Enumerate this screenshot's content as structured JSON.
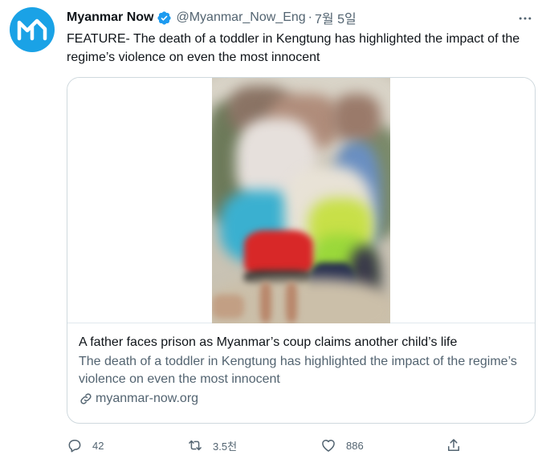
{
  "tweet": {
    "author_name": "Myanmar Now",
    "handle": "@Myanmar_Now_Eng",
    "separator": "·",
    "date": "7월 5일",
    "text": "FEATURE- The death of a toddler in Kengtung has highlighted the impact of the regime’s violence on even the most innocent"
  },
  "card": {
    "title": "A father faces prison as Myanmar’s coup claims another child’s life",
    "description": "The death of a toddler in Kengtung has highlighted the impact of the regime’s violence on even the most innocent",
    "domain": "myanmar-now.org"
  },
  "actions": {
    "reply_count": "42",
    "retweet_count": "3.5천",
    "like_count": "886"
  },
  "icons": [
    "avatar-logo",
    "verified-badge-icon",
    "more-icon",
    "link-icon",
    "reply-icon",
    "retweet-icon",
    "like-icon",
    "share-icon"
  ],
  "colors": {
    "brand": "#1aa2e6",
    "verified": "#1d9bf0",
    "muted": "#536471",
    "text": "#0f1419"
  }
}
